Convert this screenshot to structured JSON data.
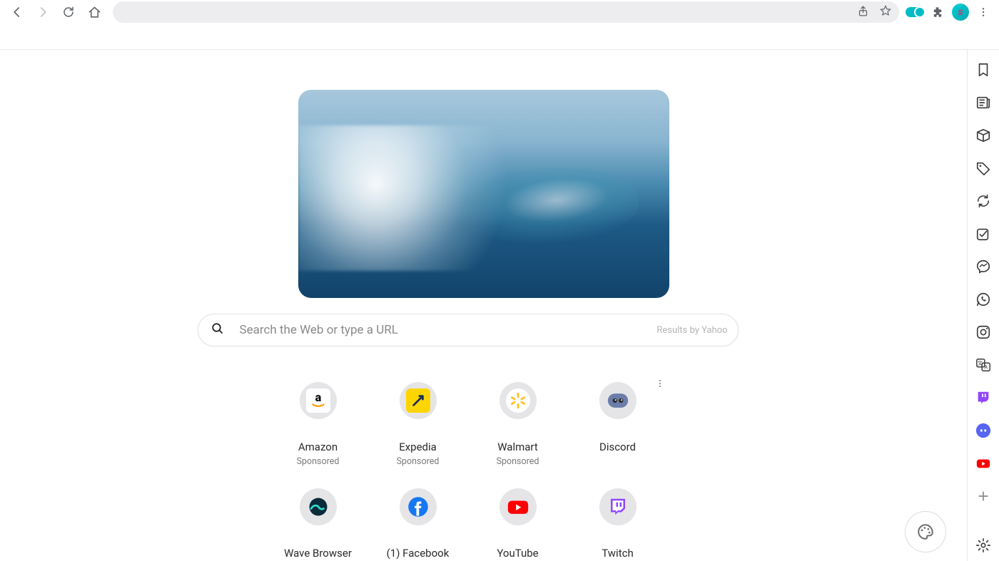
{
  "search": {
    "placeholder": "Search the Web or type a URL",
    "provider_label": "Results by Yahoo"
  },
  "shortcuts": [
    {
      "label": "Amazon",
      "sub": "Sponsored",
      "icon": "amazon"
    },
    {
      "label": "Expedia",
      "sub": "Sponsored",
      "icon": "expedia"
    },
    {
      "label": "Walmart",
      "sub": "Sponsored",
      "icon": "walmart"
    },
    {
      "label": "Discord",
      "sub": "",
      "icon": "discord"
    },
    {
      "label": "Wave Browser",
      "sub": "",
      "icon": "wave"
    },
    {
      "label": "(1) Facebook",
      "sub": "",
      "icon": "facebook"
    },
    {
      "label": "YouTube",
      "sub": "",
      "icon": "youtube"
    },
    {
      "label": "Twitch",
      "sub": "",
      "icon": "twitch"
    }
  ],
  "rail_icons": [
    "bookmark",
    "news",
    "package",
    "tag",
    "sync",
    "checkbox",
    "messenger",
    "whatsapp",
    "instagram",
    "translate",
    "twitch",
    "discord",
    "youtube",
    "add"
  ]
}
